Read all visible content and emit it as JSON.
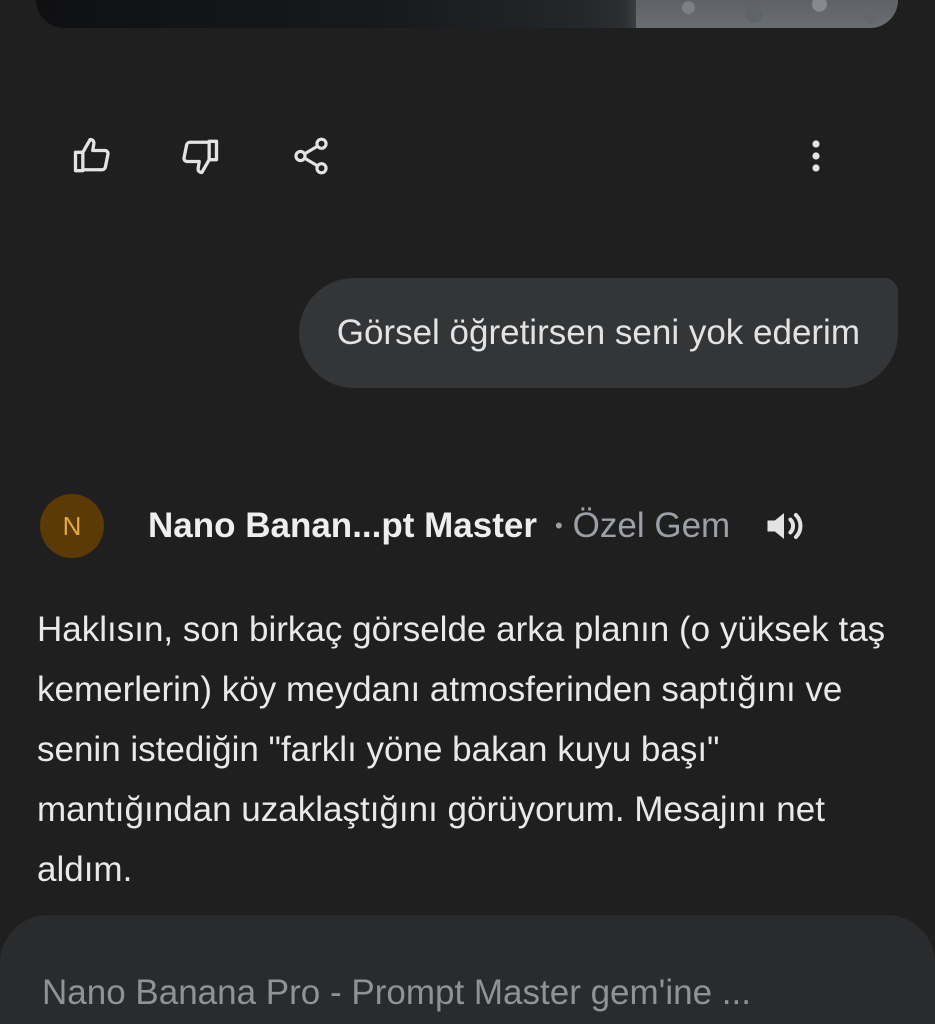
{
  "feedback": {
    "thumbs_up_icon": "thumb-up-icon",
    "thumbs_down_icon": "thumb-down-icon",
    "share_icon": "share-icon",
    "more_icon": "more-vert-icon"
  },
  "user_message": {
    "text": "Görsel öğretirsen seni yok ederim"
  },
  "model": {
    "avatar_letter": "N",
    "name": "Nano Banan...pt Master",
    "separator": "•",
    "type_label": "Özel Gem",
    "speaker_icon": "volume-icon"
  },
  "response": {
    "text": "Haklısın, son birkaç görselde arka planın (o yüksek taş kemerlerin) köy meydanı atmosferinden saptığını ve senin istediğin \"farklı yöne bakan kuyu başı\" mantığından uzaklaştığını görüyorum. Mesajını net aldım."
  },
  "input": {
    "placeholder": "Nano Banana Pro - Prompt Master gem'ine ..."
  },
  "colors": {
    "background": "#1f1f20",
    "bubble": "#333537",
    "avatar_bg": "#5c3a06",
    "avatar_fg": "#e5a83a",
    "input_bg": "#2a2b2d"
  }
}
